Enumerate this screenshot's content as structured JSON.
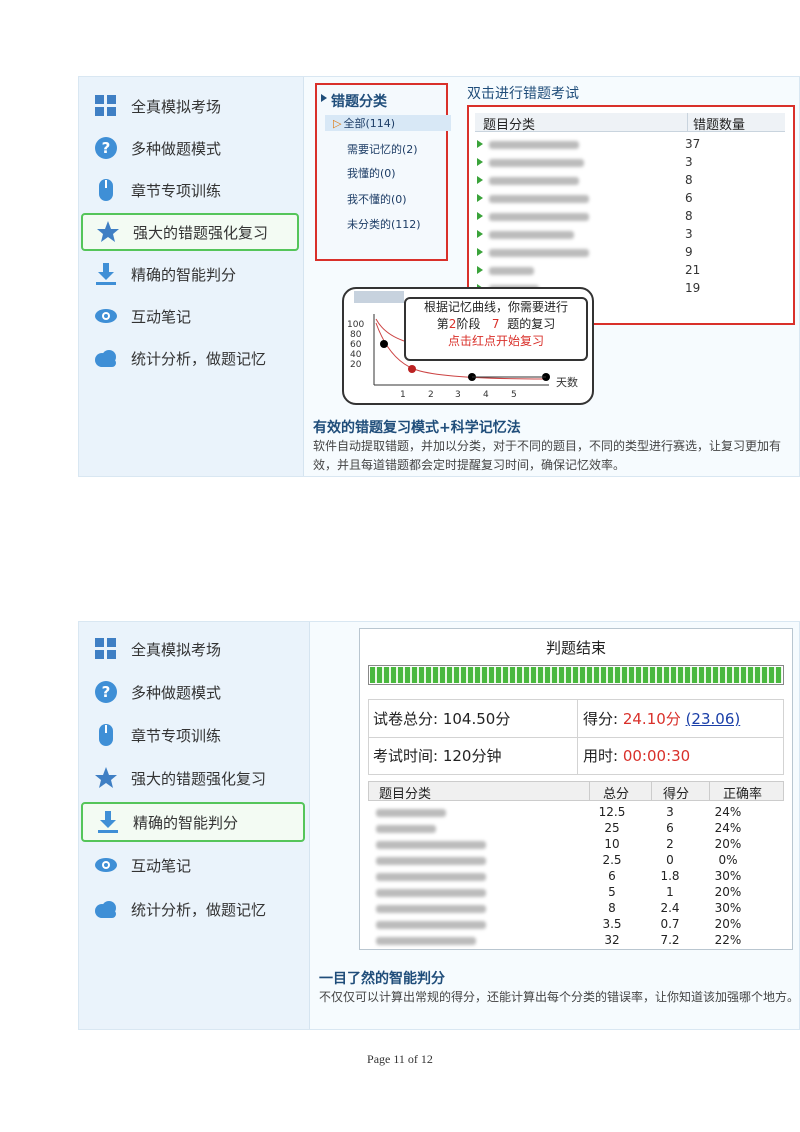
{
  "sidebar": {
    "items": [
      {
        "label": "全真模拟考场",
        "icon": "grid-icon"
      },
      {
        "label": "多种做题模式",
        "icon": "question-icon"
      },
      {
        "label": "章节专项训练",
        "icon": "mouse-icon"
      },
      {
        "label": "强大的错题强化复习",
        "icon": "star-icon"
      },
      {
        "label": "精确的智能判分",
        "icon": "download-icon"
      },
      {
        "label": "互动笔记",
        "icon": "eye-icon"
      },
      {
        "label": "统计分析，做题记忆",
        "icon": "cloud-icon"
      }
    ],
    "active_panel1": 3,
    "active_panel2": 4
  },
  "panel1": {
    "category_title": "错题分类",
    "categories": [
      "全部(114)",
      "需要记忆的(2)",
      "我懂的(0)",
      "我不懂的(0)",
      "未分类的(112)"
    ],
    "top_link": "双击进行错题考试",
    "table_headers": [
      "题目分类",
      "错题数量"
    ],
    "counts": [
      "37",
      "3",
      "8",
      "6",
      "8",
      "3",
      "9",
      "21",
      "19"
    ],
    "callout_line1": "根据记忆曲线，你需要进行",
    "callout_line2_prefix": "第",
    "callout_stage": "2",
    "callout_line2_mid": "阶段",
    "callout_num": "7",
    "callout_line2_suffix": "题的复习",
    "callout_line3": "点击红点开始复习",
    "mini_chart_y_ticks": [
      "100",
      "80",
      "60",
      "40",
      "20"
    ],
    "mini_chart_x_ticks": [
      "1",
      "2",
      "3",
      "4",
      "5"
    ],
    "mini_chart_x_unit": "天数",
    "heading": "有效的错题复习模式+科学记忆法",
    "desc": "软件自动提取错题，并加以分类，对于不同的题目，不同的类型进行赛选，让复习更加有效，并且每道错题都会定时提醒复习时间，确保记忆效率。"
  },
  "panel2": {
    "result_title": "判题结束",
    "progress_percent": 100,
    "total_label": "试卷总分:",
    "total_value": "104.50分",
    "score_label": "得分:",
    "score_value": "24.10分",
    "score_link": "(23.06)",
    "time_label": "考试时间:",
    "time_value": "120分钟",
    "used_label": "用时:",
    "used_value": "00:00:30",
    "table_headers": [
      "题目分类",
      "总分",
      "得分",
      "正确率"
    ],
    "rows": [
      [
        "12.5",
        "3",
        "24%"
      ],
      [
        "25",
        "6",
        "24%"
      ],
      [
        "10",
        "2",
        "20%"
      ],
      [
        "2.5",
        "0",
        "0%"
      ],
      [
        "6",
        "1.8",
        "30%"
      ],
      [
        "5",
        "1",
        "20%"
      ],
      [
        "8",
        "2.4",
        "30%"
      ],
      [
        "3.5",
        "0.7",
        "20%"
      ],
      [
        "32",
        "7.2",
        "22%"
      ]
    ],
    "heading": "一目了然的智能判分",
    "desc": "不仅仅可以计算出常规的得分，还能计算出每个分类的错误率，让你知道该加强哪个地方。"
  },
  "footer": {
    "page": "Page 11 of 12"
  },
  "colors": {
    "accent_red": "#d9302a",
    "accent_green": "#55c55a",
    "link_blue": "#1a3fa8"
  }
}
